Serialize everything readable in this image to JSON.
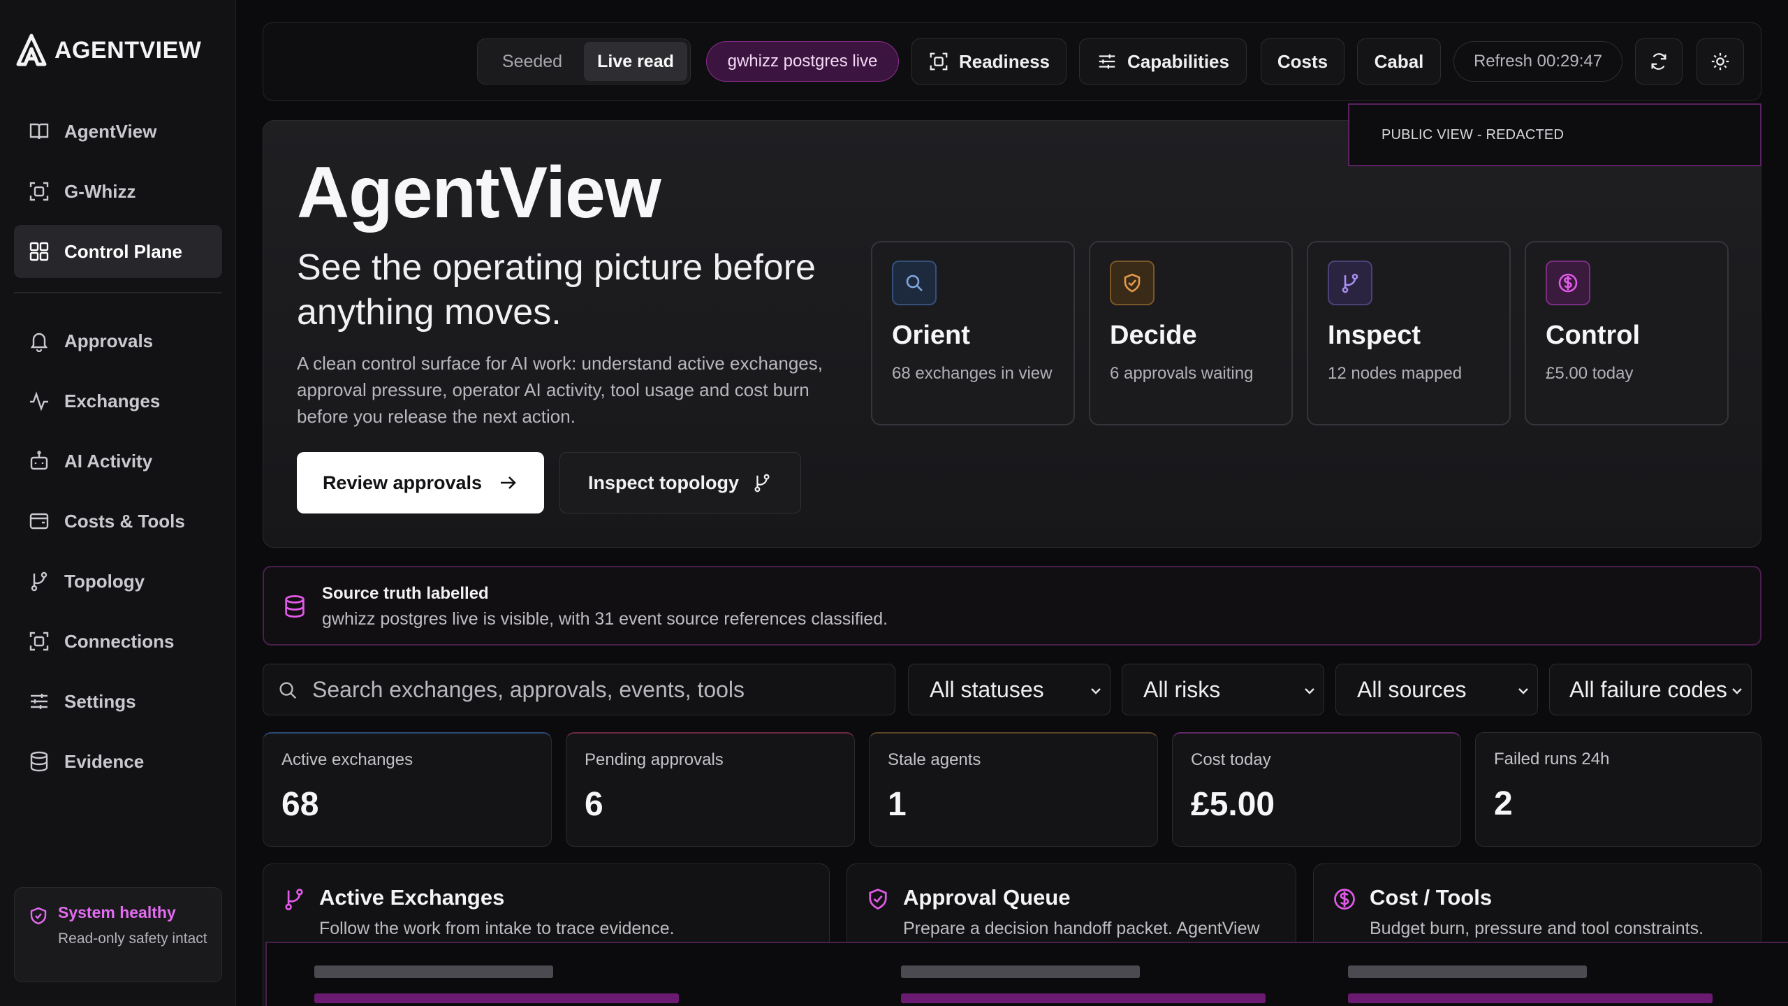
{
  "brand": {
    "name": "AGENTVIEW"
  },
  "sidebar": {
    "items": [
      {
        "label": "AgentView",
        "icon": "book-icon"
      },
      {
        "label": "G-Whizz",
        "icon": "scan-icon"
      },
      {
        "label": "Control Plane",
        "icon": "grid-icon",
        "active": true
      },
      {
        "label": "Approvals",
        "icon": "bell-icon"
      },
      {
        "label": "Exchanges",
        "icon": "activity-icon"
      },
      {
        "label": "AI Activity",
        "icon": "bot-icon"
      },
      {
        "label": "Costs & Tools",
        "icon": "wallet-icon"
      },
      {
        "label": "Topology",
        "icon": "branch-icon"
      },
      {
        "label": "Connections",
        "icon": "scan-icon"
      },
      {
        "label": "Settings",
        "icon": "sliders-icon"
      },
      {
        "label": "Evidence",
        "icon": "database-icon"
      }
    ],
    "health": {
      "title": "System healthy",
      "subtitle": "Read-only safety intact"
    }
  },
  "topbar": {
    "mode": {
      "options": [
        "Seeded",
        "Live read"
      ],
      "selected": "Live read"
    },
    "source_chip": "gwhizz postgres live",
    "readiness": "Readiness",
    "capabilities": "Capabilities",
    "costs": "Costs",
    "cabal": "Cabal",
    "refresh": "Refresh 00:29:47",
    "public_banner": "PUBLIC VIEW - REDACTED"
  },
  "hero": {
    "title": "AgentView",
    "subtitle": "See the operating picture before anything moves.",
    "description": "A clean control surface for AI work: understand active exchanges, approval pressure, operator AI activity, tool usage and cost burn before you release the next action.",
    "primary_button": "Review approvals",
    "secondary_button": "Inspect topology",
    "cards": [
      {
        "title": "Orient",
        "subtitle": "68 exchanges in view",
        "icon": "search-icon",
        "color": "#5a86c8"
      },
      {
        "title": "Decide",
        "subtitle": "6 approvals waiting",
        "icon": "shield-icon",
        "color": "#d8893a"
      },
      {
        "title": "Inspect",
        "subtitle": "12 nodes mapped",
        "icon": "branch-icon",
        "color": "#9a7be0"
      },
      {
        "title": "Control",
        "subtitle": "£5.00 today",
        "icon": "dollar-icon",
        "color": "#d04ad6"
      }
    ]
  },
  "source_truth": {
    "title": "Source truth labelled",
    "body": "gwhizz postgres live is visible, with 31 event source references classified."
  },
  "filters": {
    "search_placeholder": "Search exchanges, approvals, events, tools",
    "statuses": "All statuses",
    "risks": "All risks",
    "sources": "All sources",
    "failure_codes": "All failure codes"
  },
  "metrics": [
    {
      "label": "Active exchanges",
      "value": "68",
      "accent": "#2c4a78"
    },
    {
      "label": "Pending approvals",
      "value": "6",
      "accent": "#6a2a44"
    },
    {
      "label": "Stale agents",
      "value": "1",
      "accent": "#2a2a2f"
    },
    {
      "label": "Cost today",
      "value": "£5.00",
      "accent": "#5e2a64"
    },
    {
      "label": "Failed runs 24h",
      "value": "2",
      "accent": "#2a2a2f"
    }
  ],
  "panels": [
    {
      "title": "Active Exchanges",
      "subtitle": "Follow the work from intake to trace evidence.",
      "icon": "branch-icon"
    },
    {
      "title": "Approval Queue",
      "subtitle": "Prepare a decision handoff packet. AgentView",
      "icon": "shield-icon"
    },
    {
      "title": "Cost / Tools",
      "subtitle": "Budget burn, pressure and tool constraints.",
      "icon": "dollar-icon"
    }
  ],
  "colors": {
    "accent": "#d04ad6",
    "background": "#0b0b0d",
    "sidebar": "#121214"
  }
}
